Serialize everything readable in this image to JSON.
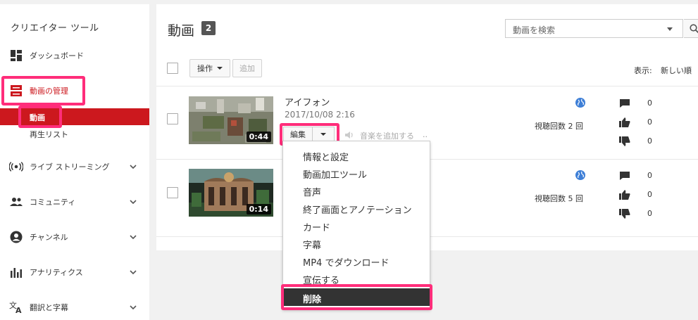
{
  "sidebar": {
    "title": "クリエイター ツール",
    "items": [
      {
        "label": "ダッシュボード",
        "icon": "dashboard-icon"
      },
      {
        "label": "動画の管理",
        "icon": "video-manager-icon"
      },
      {
        "label": "ライブ ストリーミング",
        "icon": "live-icon"
      },
      {
        "label": "コミュニティ",
        "icon": "community-icon"
      },
      {
        "label": "チャンネル",
        "icon": "channel-icon"
      },
      {
        "label": "アナリティクス",
        "icon": "analytics-icon"
      },
      {
        "label": "翻訳と字幕",
        "icon": "translate-icon"
      }
    ],
    "sub_items": [
      {
        "label": "動画"
      },
      {
        "label": "再生リスト"
      }
    ]
  },
  "main": {
    "title": "動画",
    "count": "2",
    "search_placeholder": "動画を検索",
    "actions_label": "操作",
    "add_label": "追加",
    "sort_label": "表示:",
    "sort_value": "新しい順"
  },
  "videos": [
    {
      "title": "アイフォン",
      "date": "2017/10/08 2:16",
      "duration": "0:44",
      "views": "視聴回数 2 回",
      "comments": "0",
      "likes": "0",
      "dislikes": "0"
    },
    {
      "title": "",
      "date": "",
      "duration": "0:14",
      "views": "視聴回数 5 回",
      "comments": "0",
      "likes": "0",
      "dislikes": "0"
    }
  ],
  "edit": {
    "edit_label": "編集",
    "add_music_label": "音楽を追加する",
    "more": ".."
  },
  "menu": {
    "items": [
      "情報と設定",
      "動画加工ツール",
      "音声",
      "終了画面とアノテーション",
      "カード",
      "字幕",
      "MP4 でダウンロード",
      "宣伝する",
      "削除"
    ]
  },
  "colors": {
    "accent_red": "#cc181e",
    "highlight": "#ff2d7a",
    "globe_blue": "#3e7fd7"
  }
}
